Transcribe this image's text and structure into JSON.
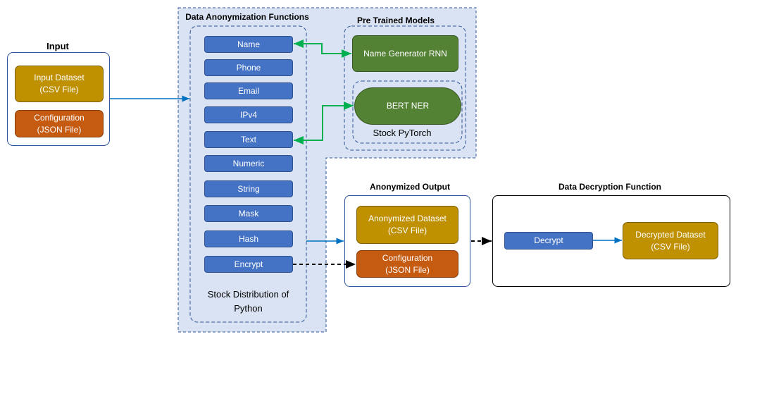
{
  "input": {
    "title": "Input",
    "dataset": "Input Dataset\n(CSV File)",
    "dataset_l1": "Input Dataset",
    "dataset_l2": "(CSV File)",
    "config_l1": "Configuration",
    "config_l2": "(JSON File)"
  },
  "anonymization": {
    "title": "Data Anonymization Functions",
    "functions": [
      "Name",
      "Phone",
      "Email",
      "IPv4",
      "Text",
      "Numeric",
      "String",
      "Mask",
      "Hash",
      "Encrypt"
    ],
    "footer_l1": "Stock Distribution of",
    "footer_l2": "Python"
  },
  "models": {
    "title": "Pre Trained Models",
    "rnn": "Name Generator RNN",
    "bert": "BERT NER",
    "bert_container": "Stock PyTorch"
  },
  "output": {
    "title": "Anonymized Output",
    "dataset_l1": "Anonymized Dataset",
    "dataset_l2": "(CSV File)",
    "config_l1": "Configuration",
    "config_l2": "(JSON File)"
  },
  "decryption": {
    "title": "Data Decryption Function",
    "decrypt": "Decrypt",
    "result_l1": "Decrypted Dataset",
    "result_l2": "(CSV File)"
  },
  "colors": {
    "function": "#4472C4",
    "dataset": "#BF9000",
    "config": "#C55A11",
    "model": "#548235",
    "region": "#DAE3F3",
    "flow": "#0070C0",
    "model_link": "#00B050"
  }
}
